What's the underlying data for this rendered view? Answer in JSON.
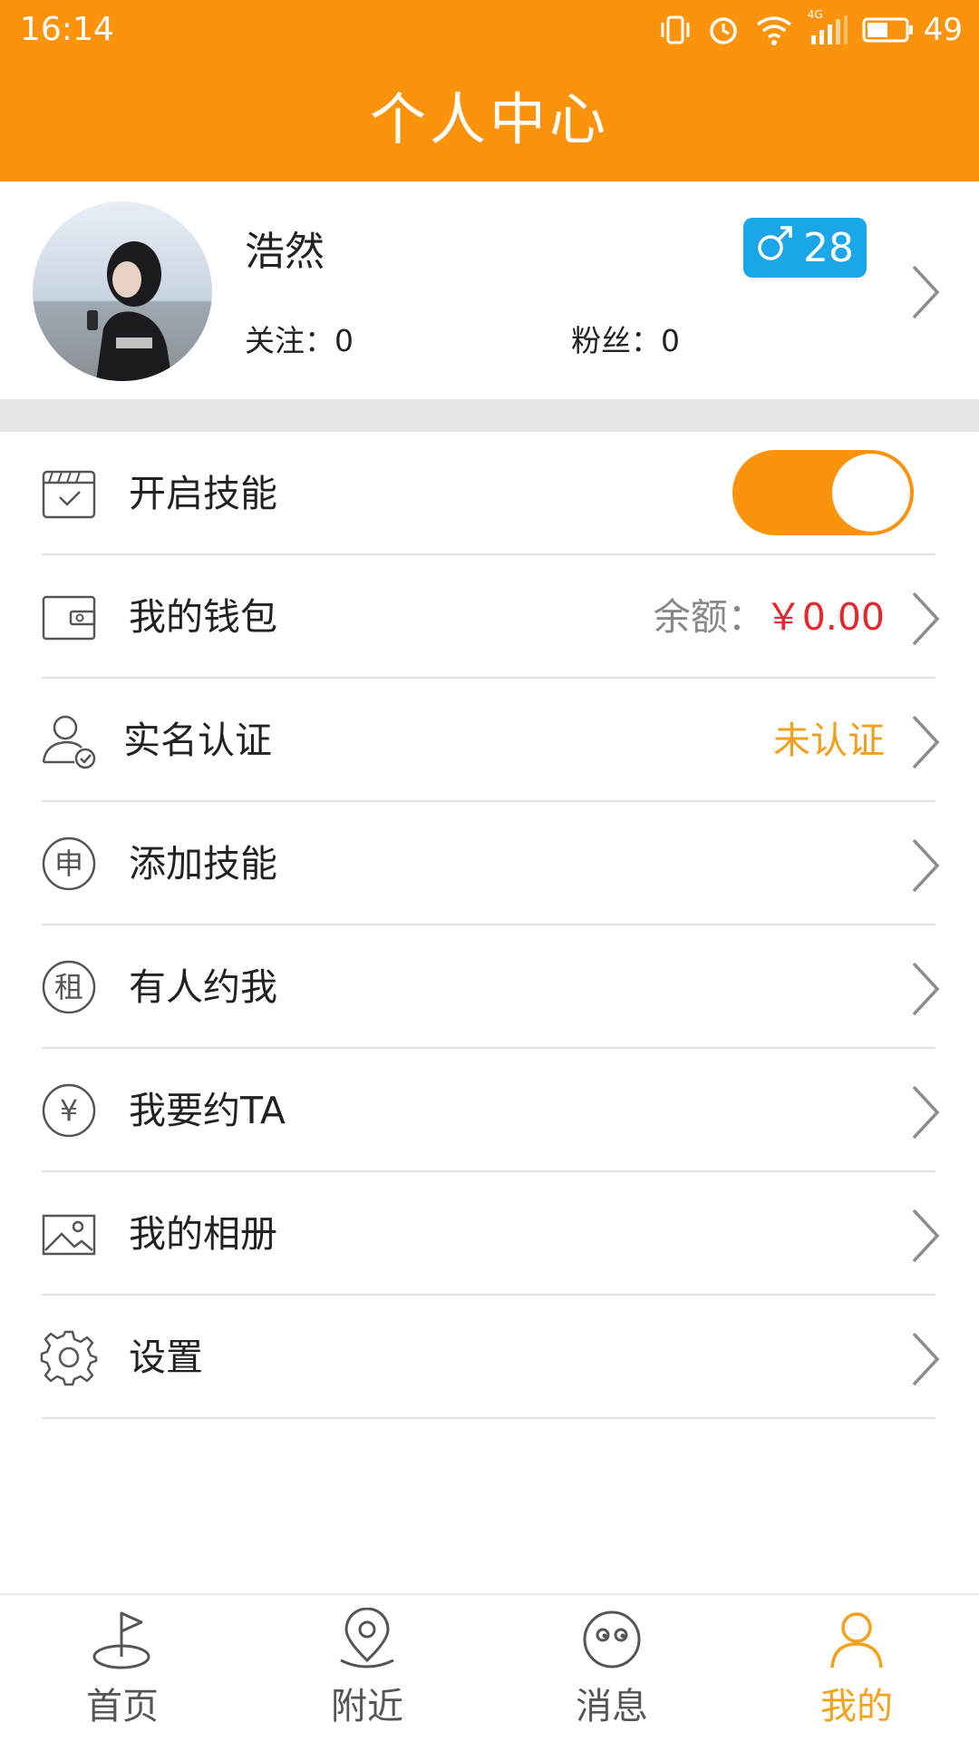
{
  "status_bar": {
    "time": "16:14",
    "network": "4G",
    "battery": "49"
  },
  "header": {
    "title": "个人中心"
  },
  "profile": {
    "username": "浩然",
    "gender_icon": "male-icon",
    "age": "28",
    "follow_label": "关注：",
    "follow_count": "0",
    "fans_label": "粉丝：",
    "fans_count": "0"
  },
  "menu": [
    {
      "label": "开启技能",
      "icon": "calendar-check-icon",
      "toggle_on": true
    },
    {
      "label": "我的钱包",
      "icon": "wallet-icon",
      "balance_label": "余额：",
      "balance_value": "￥0.00"
    },
    {
      "label": "实名认证",
      "icon": "user-verified-icon",
      "status": "未认证"
    },
    {
      "label": "添加技能",
      "icon": "apply-icon",
      "icon_char": "申"
    },
    {
      "label": "有人约我",
      "icon": "rent-icon",
      "icon_char": "租"
    },
    {
      "label": "我要约TA",
      "icon": "yen-icon",
      "icon_char": "¥"
    },
    {
      "label": "我的相册",
      "icon": "image-icon"
    },
    {
      "label": "设置",
      "icon": "gear-icon"
    }
  ],
  "tabbar": [
    {
      "label": "首页",
      "icon": "golf-flag-icon",
      "active": false
    },
    {
      "label": "附近",
      "icon": "location-pin-icon",
      "active": false
    },
    {
      "label": "消息",
      "icon": "face-icon",
      "active": false
    },
    {
      "label": "我的",
      "icon": "person-icon",
      "active": true
    }
  ],
  "colors": {
    "brand_orange": "#FB930C",
    "badge_blue": "#1AA6E8",
    "balance_red": "#E8262D",
    "warn_orange": "#F0A01E",
    "tab_active": "#F4A11E"
  }
}
